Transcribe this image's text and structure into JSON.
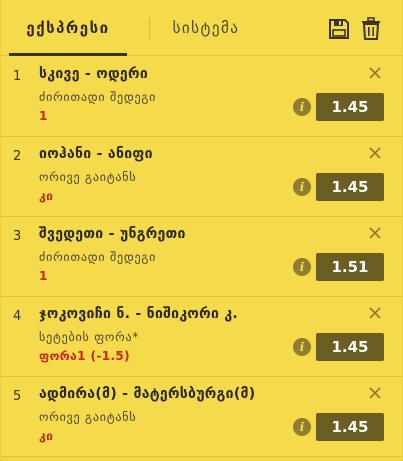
{
  "tabs": {
    "express": "ექსპრესი",
    "system": "სისტემა"
  },
  "icons": {
    "save": "save-icon",
    "trash": "trash-icon",
    "close": "close-icon",
    "info": "info-icon"
  },
  "colors": {
    "background": "#f5da4b",
    "odds_button": "#6b5e22",
    "pick_text": "#d0211a",
    "info_icon": "#8d7e30"
  },
  "bets": [
    {
      "num": "1",
      "match": "სკივე - ოდერი",
      "market": "ძირითადი შედეგი",
      "pick": "1",
      "odds": "1.45"
    },
    {
      "num": "2",
      "match": "იოჰანი - ანიფი",
      "market": "ორივე გაიტანს",
      "pick": "კი",
      "odds": "1.45"
    },
    {
      "num": "3",
      "match": "შვედეთი - უნგრეთი",
      "market": "ძირითადი შედეგი",
      "pick": "1",
      "odds": "1.51"
    },
    {
      "num": "4",
      "match": "ჯოკოვიჩი ნ. - ნიშიკორი კ.",
      "market": "სეტების ფორა*",
      "pick": "ფორა1 (-1.5)",
      "odds": "1.45"
    },
    {
      "num": "5",
      "match": "ადმირა(მ) - მატერსბურგი(მ)",
      "market": "ორივე გაიტანს",
      "pick": "კი",
      "odds": "1.45"
    }
  ]
}
